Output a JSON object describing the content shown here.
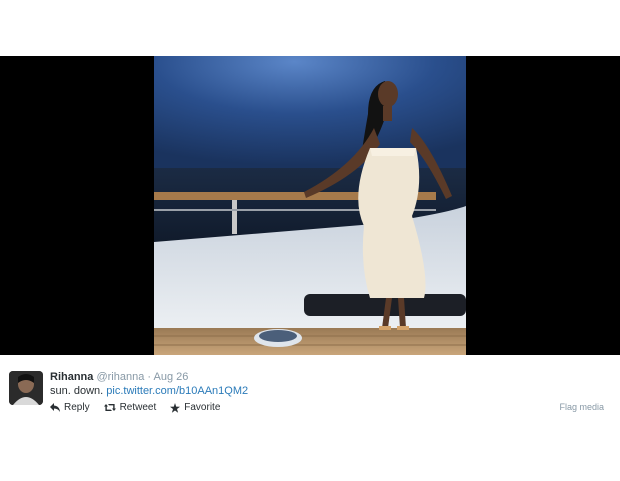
{
  "tweet": {
    "author_name": "Rihanna",
    "author_handle": "@rihanna",
    "separator": "·",
    "date": "Aug 26",
    "text": "sun. down.",
    "link": "pic.twitter.com/b10AAn1QM2"
  },
  "actions": {
    "reply_label": "Reply",
    "retweet_label": "Retweet",
    "favorite_label": "Favorite",
    "flag_label": "Flag media"
  },
  "icons": {
    "reply": "reply-icon",
    "retweet": "retweet-icon",
    "favorite": "star-icon"
  },
  "colors": {
    "link": "#2b7bb9",
    "muted": "#8899a6",
    "text": "#292f33",
    "media_background": "#000000"
  }
}
